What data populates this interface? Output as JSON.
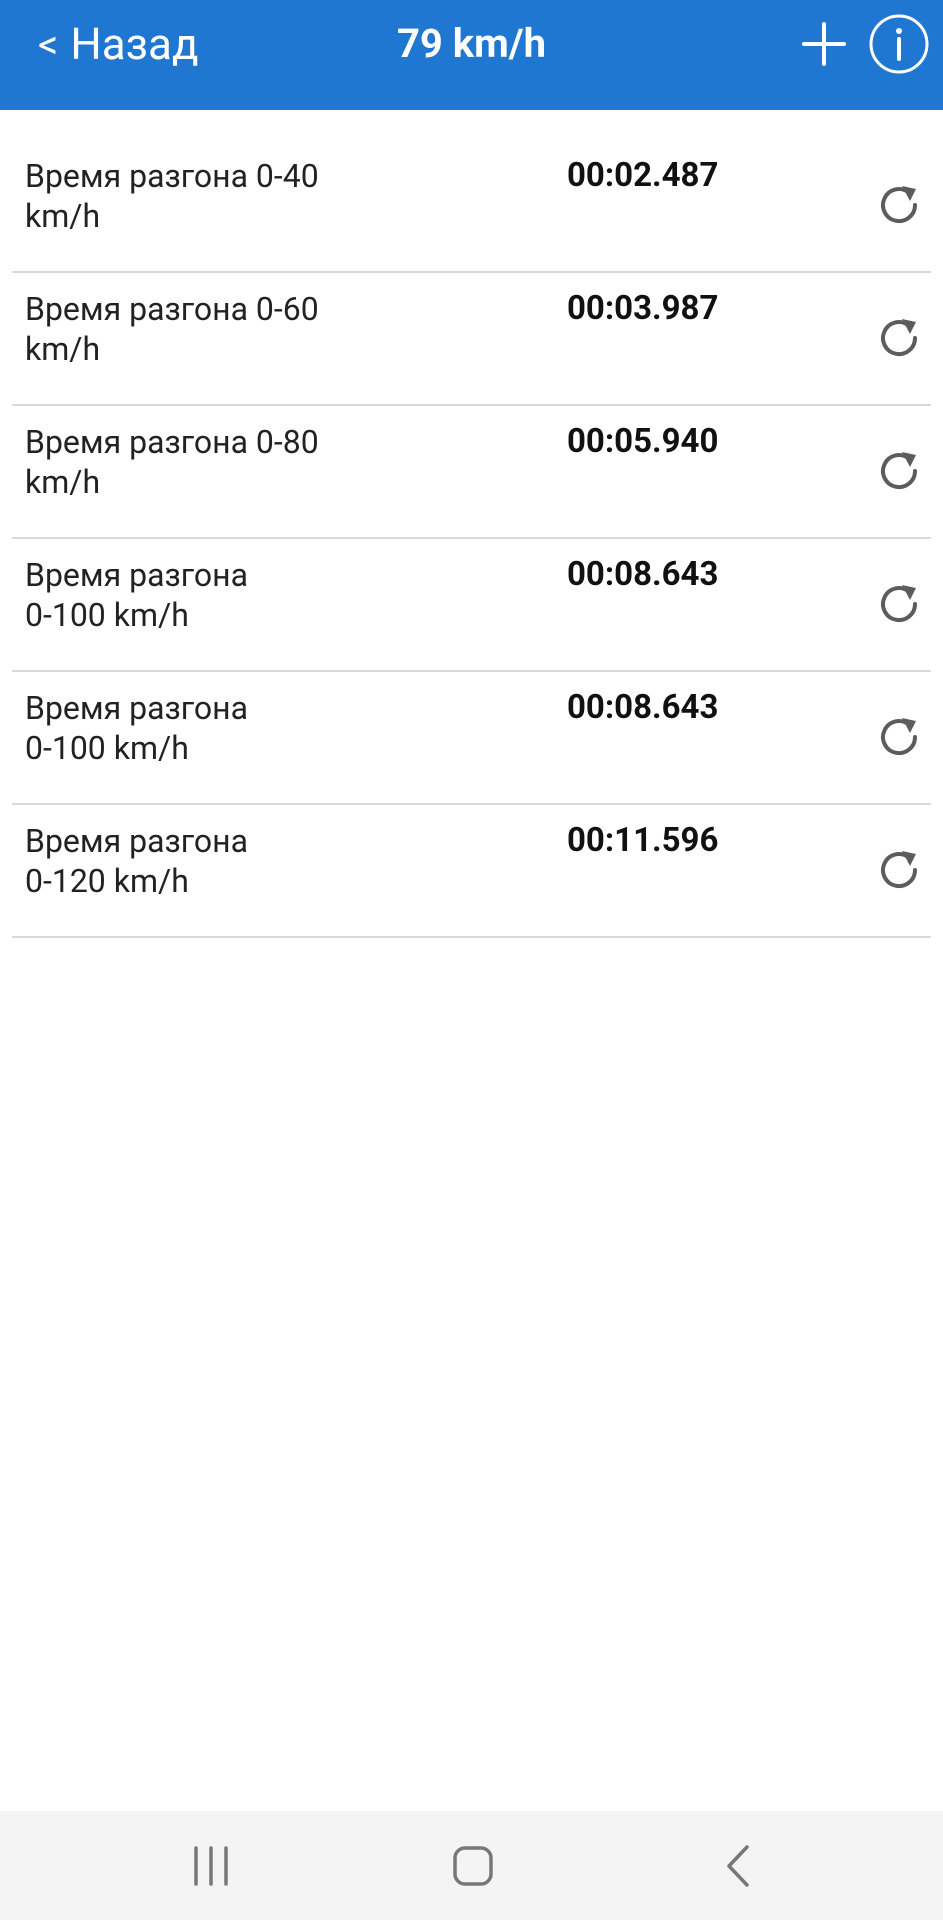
{
  "header": {
    "back_label": "Назад",
    "back_chevron": "<",
    "title": "79 km/h",
    "accent_color": "#1f77d2",
    "icons": [
      "plus-icon",
      "info-icon"
    ]
  },
  "list": {
    "items": [
      {
        "label": "Время разгона  0-40\nkm/h",
        "time": "00:02.487"
      },
      {
        "label": "Время разгона  0-60\nkm/h",
        "time": "00:03.987"
      },
      {
        "label": "Время разгона  0-80\nkm/h",
        "time": "00:05.940"
      },
      {
        "label": "Время разгона\n0-100 km/h",
        "time": "00:08.643"
      },
      {
        "label": "Время разгона\n0-100 km/h",
        "time": "00:08.643"
      },
      {
        "label": "Время разгона\n0-120 km/h",
        "time": "00:11.596"
      }
    ],
    "row_icon": "refresh-icon"
  },
  "navbar": {
    "icons": [
      "recent-apps-icon",
      "home-icon",
      "back-icon"
    ]
  }
}
